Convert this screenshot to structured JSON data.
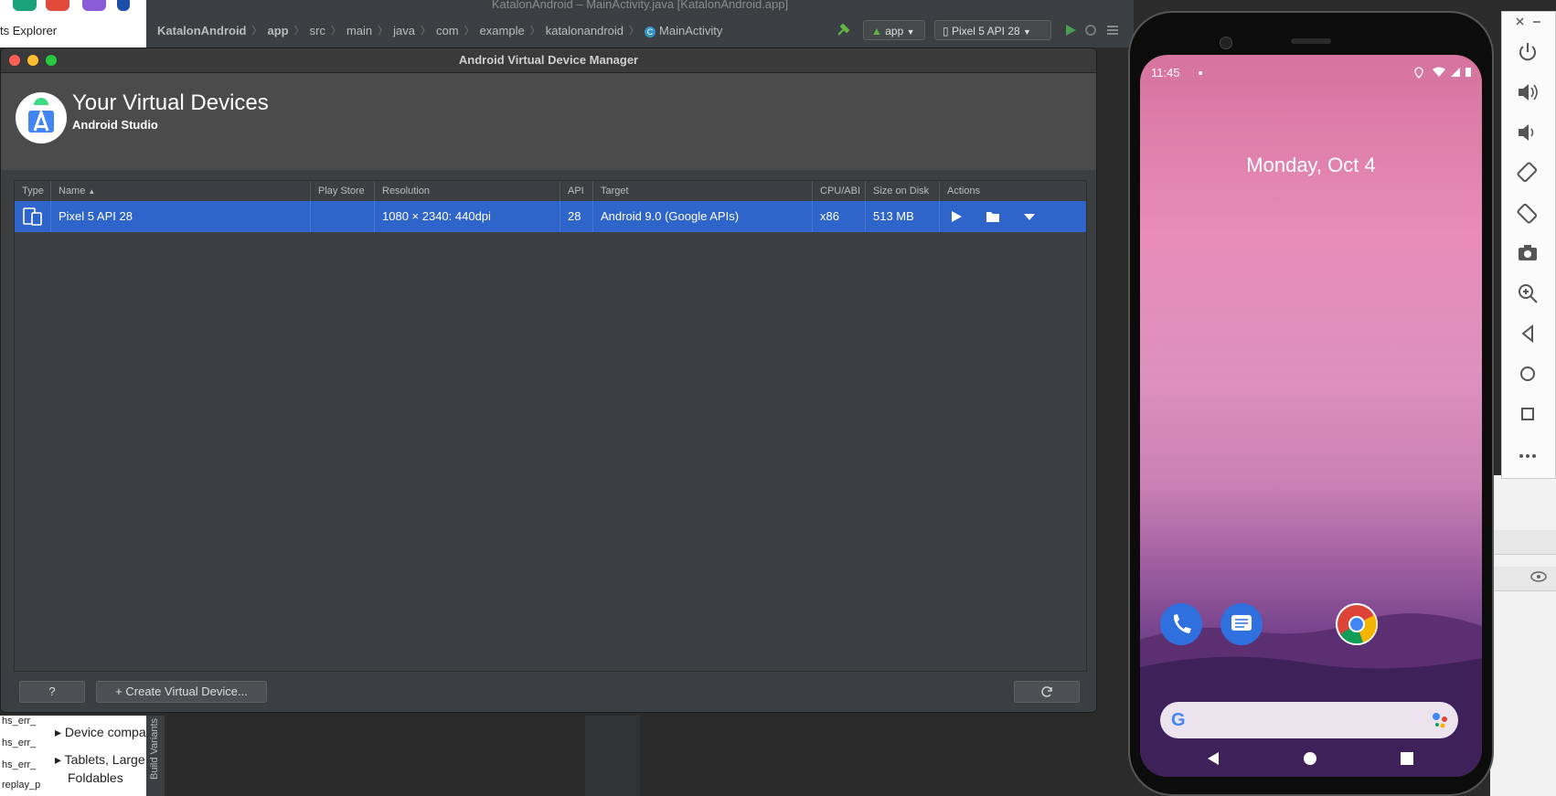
{
  "background": {
    "explorer_label": "ts Explorer",
    "ide_title": "KatalonAndroid – MainActivity.java [KatalonAndroid.app]",
    "breadcrumbs": [
      "KatalonAndroid",
      "app",
      "src",
      "main",
      "java",
      "com",
      "example",
      "katalonandroid",
      "MainActivity"
    ],
    "run_config": "app",
    "device_selector": "Pixel 5 API 28",
    "file_list": [
      "hs_err_",
      "hs_err_",
      "hs_err_",
      "replay_p"
    ],
    "tree_items": [
      "Device compa",
      "Tablets, Large",
      "Foldables"
    ],
    "build_variants_label": "Build Variants"
  },
  "avd": {
    "window_title": "Android Virtual Device Manager",
    "heading": "Your Virtual Devices",
    "subheading": "Android Studio",
    "columns": [
      "Type",
      "Name",
      "Play Store",
      "Resolution",
      "API",
      "Target",
      "CPU/ABI",
      "Size on Disk",
      "Actions"
    ],
    "device": {
      "name": "Pixel 5 API 28",
      "play_store": "",
      "resolution": "1080 × 2340: 440dpi",
      "api": "28",
      "target": "Android 9.0 (Google APIs)",
      "cpu": "x86",
      "size": "513 MB"
    },
    "help_label": "?",
    "create_label": "+ Create Virtual Device..."
  },
  "emulator": {
    "time": "11:45",
    "date": "Monday, Oct 4",
    "google_letter": "G"
  },
  "colors": {
    "selection": "#2f65ca",
    "close": "#fe5f57",
    "minimize": "#febc2e",
    "zoom": "#28c840"
  }
}
